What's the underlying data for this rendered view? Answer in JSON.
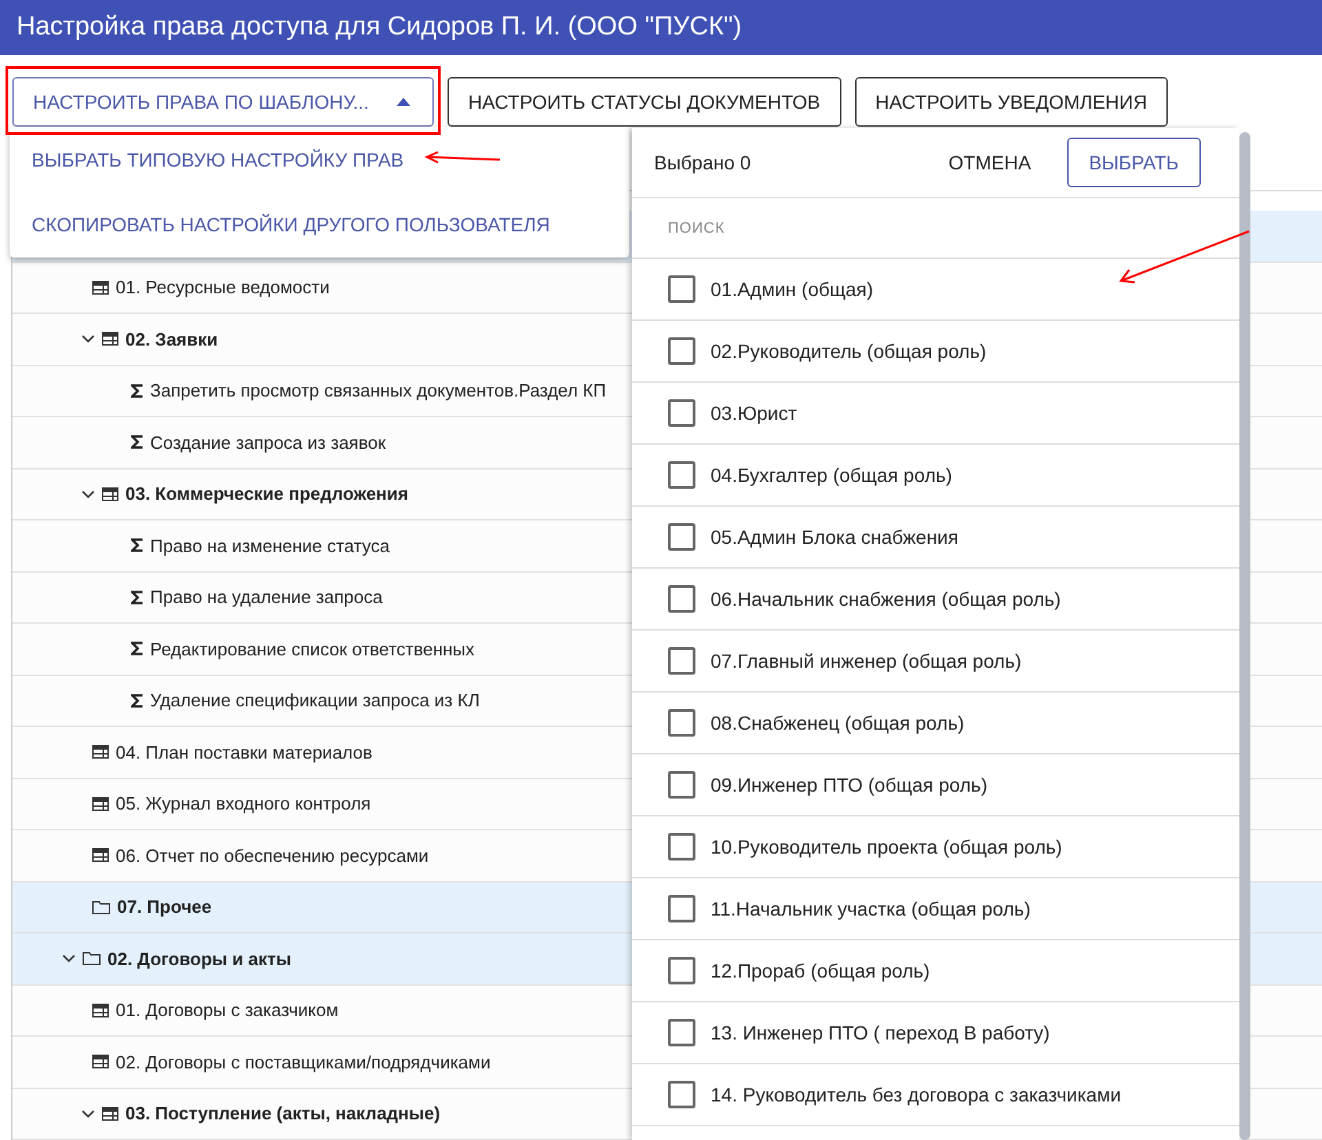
{
  "window": {
    "title": "Настройка права доступа для Сидоров П. И. (ООО \"ПУСК\")"
  },
  "toolbar": [
    {
      "label": "НАСТРОИТЬ ПРАВА ПО ШАБЛОНУ...",
      "kind": "menu",
      "expanded": true
    },
    {
      "label": "НАСТРОИТЬ СТАТУСЫ ДОКУМЕНТОВ",
      "kind": "plain"
    },
    {
      "label": "НАСТРОИТЬ УВЕДОМЛЕНИЯ",
      "kind": "plain"
    }
  ],
  "template_menu": [
    "ВЫБРАТЬ ТИПОВУЮ НАСТРОЙКУ ПРАВ",
    "СКОПИРОВАТЬ НАСТРОЙКИ ДРУГОГО ПОЛЬЗОВАТЕЛЯ"
  ],
  "tree": [
    {
      "kind": "folder",
      "children": [
        {
          "label": "01. Ресурсные ведомости",
          "kind": "table"
        },
        {
          "label": "02. Заявки",
          "kind": "table",
          "expanded": true,
          "children": [
            {
              "label": "Запретить просмотр связанных документов.Раздел КП",
              "kind": "formula"
            },
            {
              "label": "Создание запроса из заявок",
              "kind": "formula"
            }
          ]
        },
        {
          "label": "03. Коммерческие предложения",
          "kind": "table",
          "expanded": true,
          "children": [
            {
              "label": "Право на изменение статуса",
              "kind": "formula"
            },
            {
              "label": "Право на удаление запроса",
              "kind": "formula"
            },
            {
              "label": "Редактирование список ответственных",
              "kind": "formula"
            },
            {
              "label": "Удаление спецификации запроса из КЛ",
              "kind": "formula"
            }
          ]
        },
        {
          "label": "04. План поставки материалов",
          "kind": "table"
        },
        {
          "label": "05. Журнал входного контроля",
          "kind": "table"
        },
        {
          "label": "06. Отчет по обеспечению ресурсами",
          "kind": "table"
        },
        {
          "label": "07. Прочее",
          "kind": "folder"
        }
      ]
    },
    {
      "label": "02. Договоры и акты",
      "kind": "folder",
      "expanded": true,
      "children": [
        {
          "label": "01. Договоры с заказчиком",
          "kind": "table"
        },
        {
          "label": "02. Договоры с поставщиками/подрядчиками",
          "kind": "table"
        },
        {
          "label": "03. Поступление (акты, накладные)",
          "kind": "table",
          "expanded": true
        }
      ]
    }
  ],
  "picker": {
    "selected_count": "Выбрано 0",
    "cancel": "ОТМЕНА",
    "confirm": "ВЫБРАТЬ",
    "search": {
      "placeholder": "ПОИСК"
    },
    "roles": [
      {
        "label": "01.Админ (общая)",
        "checked": false
      },
      {
        "label": "02.Руководитель (общая роль)",
        "checked": false
      },
      {
        "label": "03.Юрист",
        "checked": false
      },
      {
        "label": "04.Бухгалтер (общая роль)",
        "checked": false
      },
      {
        "label": "05.Админ Блока снабжения",
        "checked": false
      },
      {
        "label": "06.Начальник снабжения (общая роль)",
        "checked": false
      },
      {
        "label": "07.Главный инженер (общая роль)",
        "checked": false
      },
      {
        "label": "08.Снабженец (общая роль)",
        "checked": false
      },
      {
        "label": "09.Инженер ПТО (общая роль)",
        "checked": false
      },
      {
        "label": "10.Руководитель проекта (общая роль)",
        "checked": false
      },
      {
        "label": "11.Начальник участка (общая роль)",
        "checked": false
      },
      {
        "label": "12.Прораб (общая роль)",
        "checked": false
      },
      {
        "label": "13. Инженер ПТО ( переход В работу)",
        "checked": false
      },
      {
        "label": "14. Руководитель без договора с заказчиками",
        "checked": false
      }
    ]
  }
}
